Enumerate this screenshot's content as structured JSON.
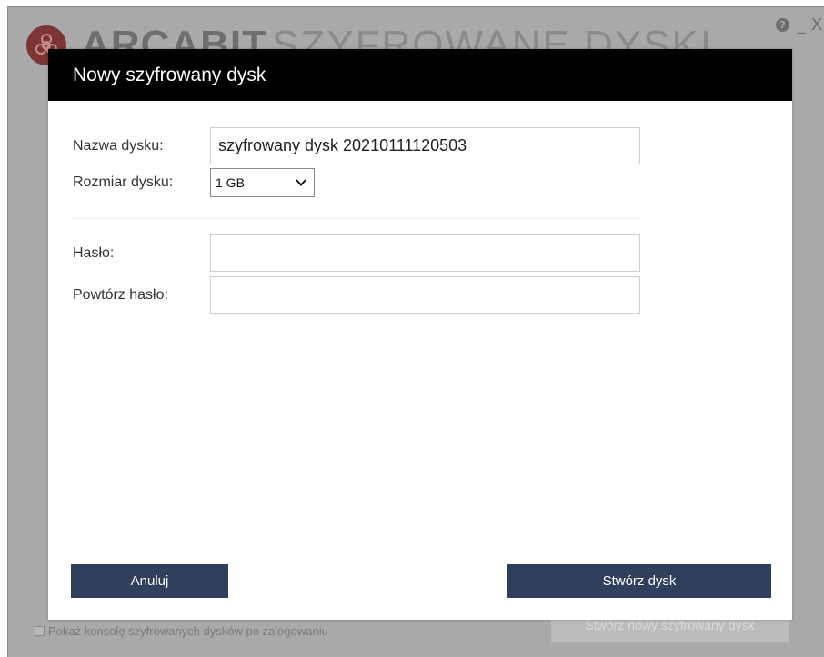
{
  "background_app": {
    "brand_name": "ARCABIT",
    "product_name": "SZYFROWANE DYSKI",
    "window_controls": {
      "help": "?",
      "minimize": "_",
      "close": "X"
    },
    "show_console_checkbox": {
      "label": "Pokaż konsolę szyfrowanych dysków po zalogowaniu",
      "checked": false
    },
    "create_new_disk_button": "Stwórz nowy szyfrowany dysk"
  },
  "dialog": {
    "title": "Nowy szyfrowany dysk",
    "fields": {
      "disk_name": {
        "label": "Nazwa dysku:",
        "value": "szyfrowany dysk 20210111120503"
      },
      "disk_size": {
        "label": "Rozmiar dysku:",
        "selected": "1 GB"
      },
      "password": {
        "label": "Hasło:",
        "value": ""
      },
      "repeat_password": {
        "label": "Powtórz hasło:",
        "value": ""
      }
    },
    "buttons": {
      "cancel": "Anuluj",
      "create": "Stwórz dysk"
    }
  },
  "colors": {
    "dialog_header_bg": "#000000",
    "button_bg": "#2f3f5c",
    "overlay_bg": "#a9a9a9",
    "brand_logo": "#7c3434"
  },
  "icons": {
    "brand_logo": "biohazard-icon",
    "select_arrow": "chevron-down-icon",
    "help": "help-icon",
    "minimize": "minimize-icon",
    "close": "close-icon"
  }
}
